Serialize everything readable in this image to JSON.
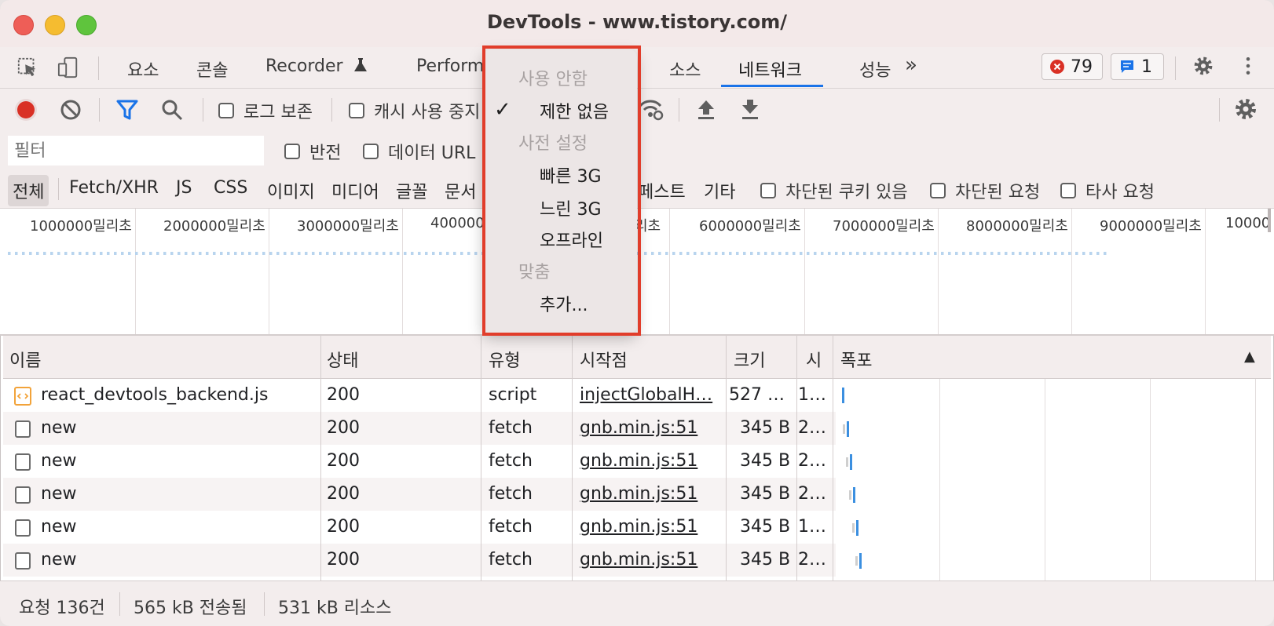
{
  "window": {
    "title": "DevTools - www.tistory.com/"
  },
  "tabs": [
    {
      "label": "요소"
    },
    {
      "label": "콘솔"
    },
    {
      "label": "Recorder"
    },
    {
      "label": "Perform"
    },
    {
      "label": "소스"
    },
    {
      "label": "네트워크",
      "active": true
    },
    {
      "label": "성능"
    }
  ],
  "more_tabs": "»",
  "badges": {
    "errors": "79",
    "messages": "1"
  },
  "toolbar": {
    "preserve_log": "로그 보존",
    "disable_cache": "캐시 사용 중지"
  },
  "filter": {
    "placeholder": "필터",
    "invert": "반전",
    "data_url": "데이터 URL"
  },
  "types": [
    "전체",
    "Fetch/XHR",
    "JS",
    "CSS",
    "이미지",
    "미디어",
    "글꼴",
    "문서",
    "페스트",
    "기타"
  ],
  "extra_filters": [
    "차단된 쿠키 있음",
    "차단된 요청",
    "타사 요청"
  ],
  "overview_ticks": [
    "1000000밀리초",
    "2000000밀리초",
    "3000000밀리초",
    "400000",
    "리초",
    "6000000밀리초",
    "7000000밀리초",
    "8000000밀리초",
    "9000000밀리초",
    "10000"
  ],
  "columns": {
    "name": "이름",
    "status": "상태",
    "type": "유형",
    "initiator": "시작점",
    "size": "크기",
    "time": "시",
    "waterfall": "폭포",
    "sort_arrow": "▲"
  },
  "rows": [
    {
      "name": "react_devtools_backend.js",
      "status": "200",
      "type": "script",
      "initiator": "injectGlobalH…",
      "size": "527 …",
      "time": "1…"
    },
    {
      "name": "new",
      "status": "200",
      "type": "fetch",
      "initiator": "gnb.min.js:51",
      "size": "345 B",
      "time": "2…"
    },
    {
      "name": "new",
      "status": "200",
      "type": "fetch",
      "initiator": "gnb.min.js:51",
      "size": "345 B",
      "time": "2…"
    },
    {
      "name": "new",
      "status": "200",
      "type": "fetch",
      "initiator": "gnb.min.js:51",
      "size": "345 B",
      "time": "2…"
    },
    {
      "name": "new",
      "status": "200",
      "type": "fetch",
      "initiator": "gnb.min.js:51",
      "size": "345 B",
      "time": "1…"
    },
    {
      "name": "new",
      "status": "200",
      "type": "fetch",
      "initiator": "gnb.min.js:51",
      "size": "345 B",
      "time": "2…"
    }
  ],
  "status": {
    "requests": "요청 136건",
    "transferred": "565 kB 전송됨",
    "resources": "531 kB 리소스"
  },
  "throttle_menu": {
    "header_disabled": "사용 안함",
    "no_throttle": "제한 없음",
    "check": "✓",
    "header_presets": "사전 설정",
    "fast3g": "빠른 3G",
    "slow3g": "느린 3G",
    "offline": "오프라인",
    "header_custom": "맞춤",
    "add": "추가..."
  },
  "colors": {
    "accent": "#1a73e8",
    "record": "#d93025",
    "highlight": "#e13d2b"
  }
}
